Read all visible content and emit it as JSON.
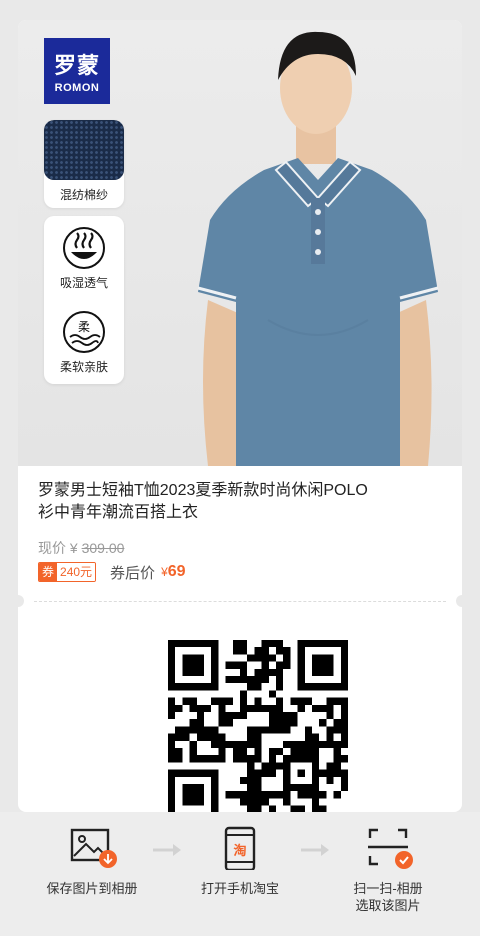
{
  "brand": {
    "logo_zh": "罗蒙",
    "logo_en": "ROMON",
    "logo_color": "#1b2a9a"
  },
  "features": [
    {
      "label": "混纺棉纱",
      "icon": "fabric-swatch"
    },
    {
      "label": "吸湿透气",
      "icon": "breathable-icon"
    },
    {
      "label": "柔软亲肤",
      "icon": "soft-icon"
    }
  ],
  "soft_icon_char": "柔",
  "product": {
    "title_line1": "罗蒙男士短袖T恤2023夏季新款时尚休闲POLO",
    "title_line2": "衫中青年潮流百搭上衣",
    "shirt_color": "#5f86a6"
  },
  "pricing": {
    "orig_label": "现价",
    "currency": "¥",
    "orig_price": "309.00",
    "coupon_tag": "券",
    "coupon_amount": "240元",
    "after_label": "券后价",
    "after_price": "69",
    "accent": "#f2642a"
  },
  "actions": [
    {
      "label": "保存图片到相册",
      "icon": "save-image-icon"
    },
    {
      "label": "打开手机淘宝",
      "icon": "taobao-phone-icon",
      "glyph": "淘"
    },
    {
      "label_line1": "扫一扫-相册",
      "label_line2": "选取该图片",
      "icon": "scan-check-icon"
    }
  ]
}
